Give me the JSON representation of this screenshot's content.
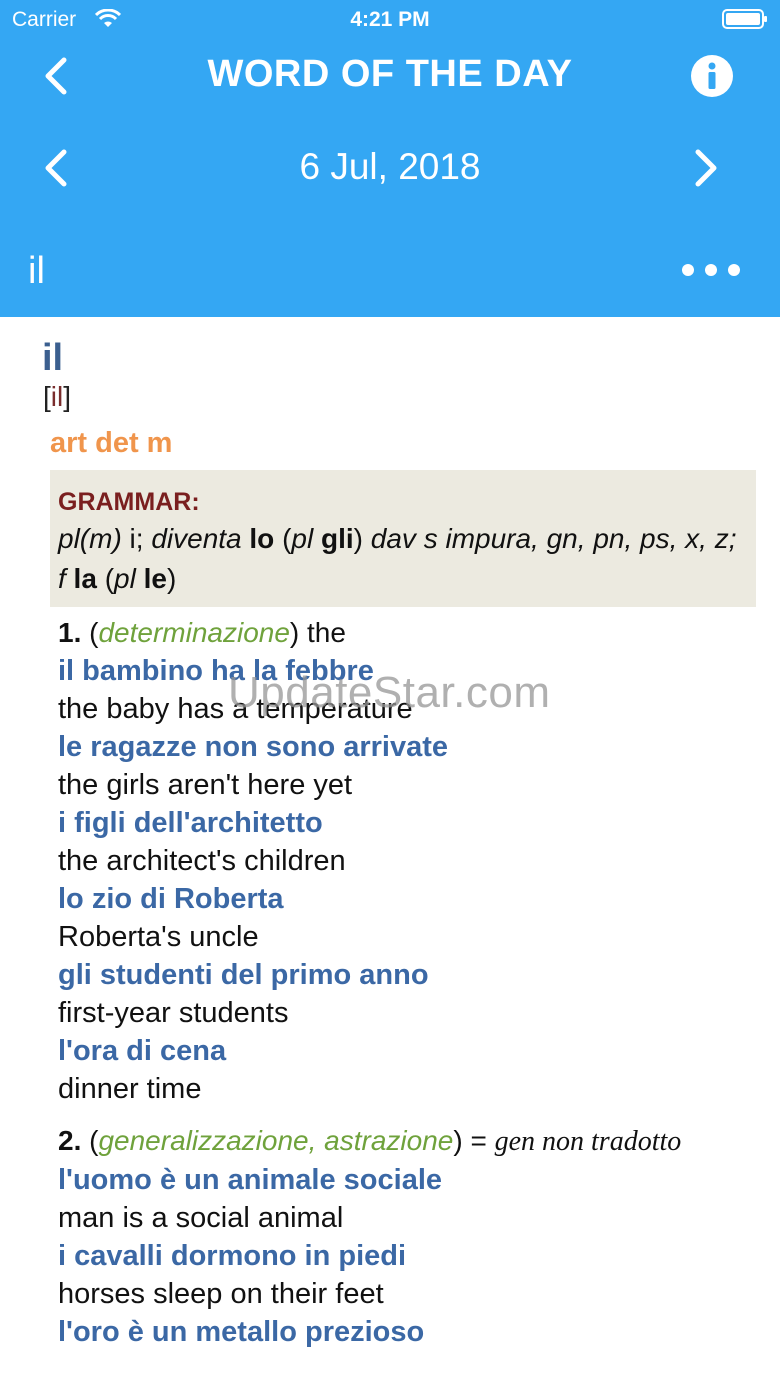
{
  "status_bar": {
    "carrier": "Carrier",
    "time": "4:21 PM"
  },
  "nav": {
    "title": "WORD OF THE DAY",
    "date": "6 Jul, 2018",
    "word": "il"
  },
  "entry": {
    "headword": "il",
    "pronunciation_open": "[",
    "pronunciation": "il",
    "pronunciation_close": "]",
    "part_of_speech": "art det m",
    "grammar_label": "GRAMMAR:",
    "grammar": {
      "p1": "pl(m)",
      "p2": " i; ",
      "p3": "diventa",
      "p4": " lo",
      "p5": " (",
      "p6": "pl",
      "p7": " gli",
      "p8": ") ",
      "p9": "dav s impura, gn, pn, ps, x, z; f",
      "p10": " la",
      "p11": " (",
      "p12": "pl",
      "p13": " le",
      "p14": ")"
    },
    "senses": [
      {
        "number": "1.",
        "open": " (",
        "context": "determinazione",
        "close": ") the",
        "note": "",
        "examples": [
          {
            "it": "il bambino ha la febbre",
            "en": "the baby has a temperature"
          },
          {
            "it": "le ragazze non sono arrivate",
            "en": "the girls aren't here yet"
          },
          {
            "it": "i figli dell'architetto",
            "en": "the architect's children"
          },
          {
            "it": "lo zio di Roberta",
            "en": "Roberta's uncle"
          },
          {
            "it": "gli studenti del primo anno",
            "en": "first-year students"
          },
          {
            "it": "l'ora di cena",
            "en": "dinner time"
          }
        ]
      },
      {
        "number": "2.",
        "open": " (",
        "context": "generalizzazione, astrazione",
        "close": ") = ",
        "note": "gen non tradotto",
        "examples": [
          {
            "it": "l'uomo è un animale sociale",
            "en": "man is a social animal"
          },
          {
            "it": "i cavalli dormono in piedi",
            "en": "horses sleep on their feet"
          },
          {
            "it": "l'oro è un metallo prezioso",
            "en": ""
          }
        ]
      }
    ]
  },
  "watermark": "UpdateStar.com",
  "colors": {
    "header_bg": "#34a7f3",
    "headword": "#3b5f8f",
    "example": "#3b68a5",
    "part_of_speech": "#f0954c",
    "context": "#6fa23c",
    "grammar_label": "#7a1f1f",
    "grammar_bg": "#eceae0"
  },
  "icons": [
    "wifi-icon",
    "battery-icon",
    "back-chevron-icon",
    "info-icon",
    "prev-chevron-icon",
    "next-chevron-icon",
    "more-dots-icon"
  ]
}
